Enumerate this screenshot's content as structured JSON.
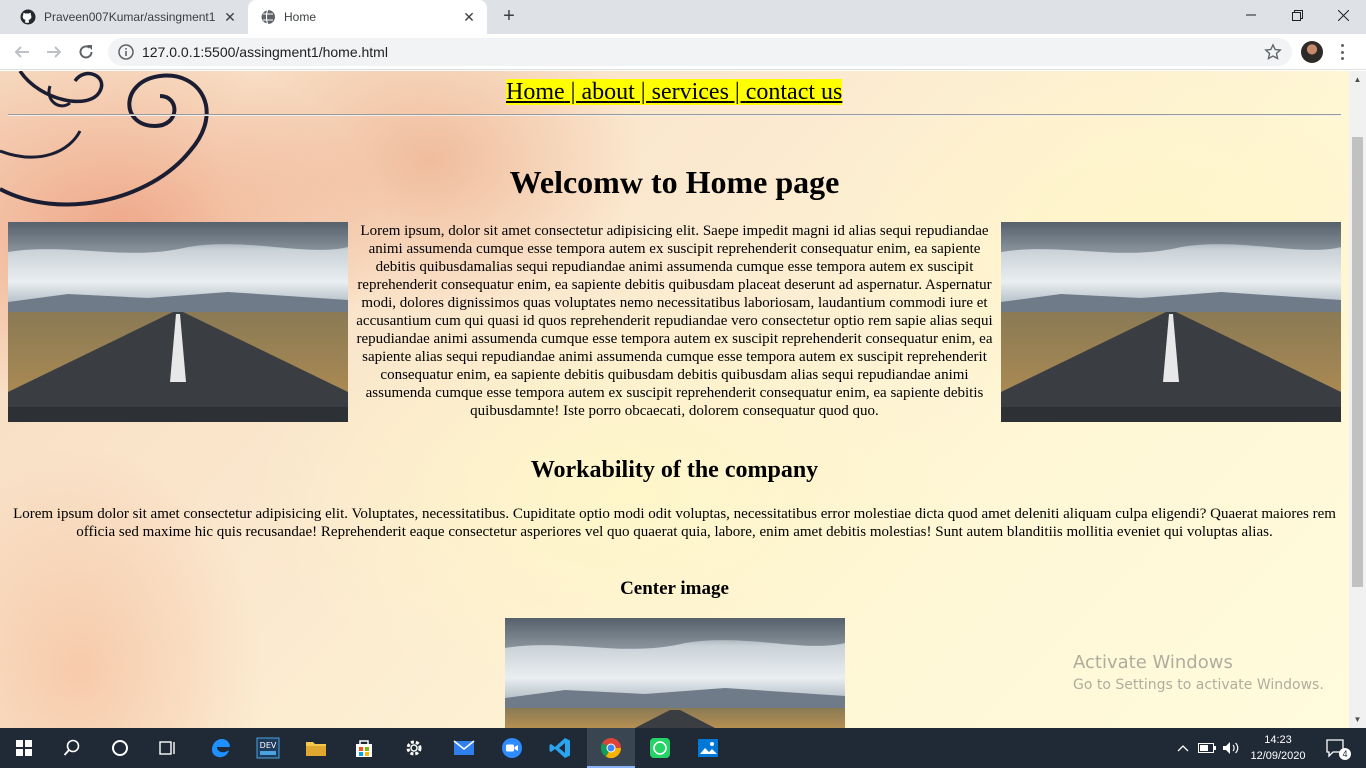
{
  "browser": {
    "tabs": [
      {
        "title": "Praveen007Kumar/assingment1",
        "favicon": "github-icon",
        "active": false
      },
      {
        "title": "Home",
        "favicon": "globe-icon",
        "active": true
      }
    ],
    "url": "127.0.0.1:5500/assingment1/home.html"
  },
  "page": {
    "nav": {
      "home": "Home",
      "about": "about",
      "services": "services",
      "contact": "contact us",
      "separator": " | "
    },
    "heading": "Welcomw to Home page",
    "main_text": "Lorem ipsum, dolor sit amet consectetur adipisicing elit. Saepe impedit magni id alias sequi repudiandae animi assumenda cumque esse tempora autem ex suscipit reprehenderit consequatur enim, ea sapiente debitis quibusdamalias sequi repudiandae animi assumenda cumque esse tempora autem ex suscipit reprehenderit consequatur enim, ea sapiente debitis quibusdam placeat deserunt ad aspernatur. Aspernatur modi, dolores dignissimos quas voluptates nemo necessitatibus laboriosam, laudantium commodi iure et accusantium cum qui quasi id quos reprehenderit repudiandae vero consectetur optio rem sapie alias sequi repudiandae animi assumenda cumque esse tempora autem ex suscipit reprehenderit consequatur enim, ea sapiente alias sequi repudiandae animi assumenda cumque esse tempora autem ex suscipit reprehenderit consequatur enim, ea sapiente debitis quibusdam debitis quibusdam alias sequi repudiandae animi assumenda cumque esse tempora autem ex suscipit reprehenderit consequatur enim, ea sapiente debitis quibusdamnte! Iste porro obcaecati, dolorem consequatur quod quo.",
    "subheading": "Workability of the company",
    "second_text": "Lorem ipsum dolor sit amet consectetur adipisicing elit. Voluptates, necessitatibus. Cupiditate optio modi odit voluptas, necessitatibus error molestiae dicta quod amet deleniti aliquam culpa eligendi? Quaerat maiores rem officia sed maxime hic quis recusandae! Reprehenderit eaque consectetur asperiores vel quo quaerat quia, labore, enim amet debitis molestias! Sunt autem blanditiis mollitia eveniet qui voluptas alias.",
    "image_heading": "Center image"
  },
  "watermark": {
    "line1": "Activate Windows",
    "line2": "Go to Settings to activate Windows."
  },
  "taskbar": {
    "apps": [
      "start-icon",
      "search-icon",
      "cortana-icon",
      "task-view-icon",
      "edge-icon",
      "dev-icon",
      "file-explorer-icon",
      "store-icon",
      "settings-icon",
      "mail-icon",
      "zoom-icon",
      "vscode-icon",
      "chrome-icon",
      "whatsapp-icon",
      "photos-icon"
    ],
    "time": "14:23",
    "date": "12/09/2020",
    "notification_count": "4"
  },
  "colors": {
    "nav_highlight": "#ffff00",
    "taskbar": "#1f2a36",
    "tabstrip": "#dee1e6"
  }
}
